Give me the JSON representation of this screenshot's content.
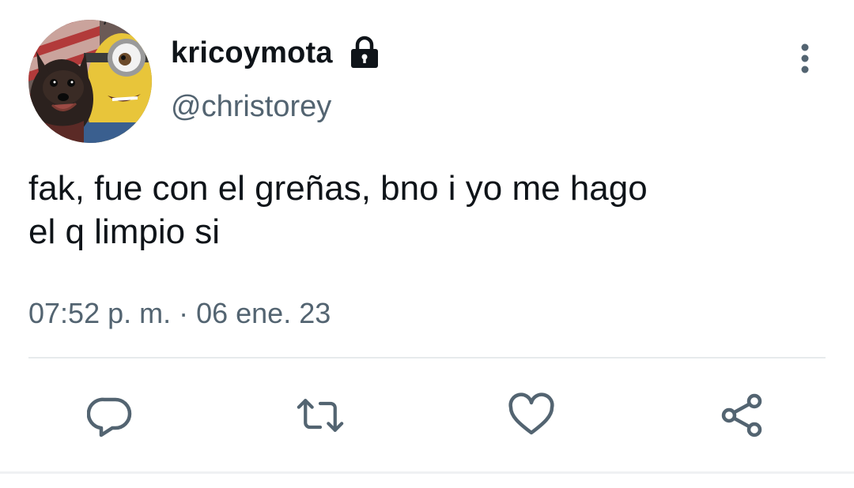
{
  "tweet": {
    "display_name": "kricoymota",
    "handle": "@christorey",
    "text_line1": "fak, fue con el greñas, bno i yo me hago",
    "text_line2": "el q limpio si",
    "timestamp": "07:52 p. m. · 06 ene. 23",
    "protected": true
  },
  "icons": {
    "lock": "lock-icon",
    "more": "more-vertical-icon",
    "reply": "reply-bubble-icon",
    "retweet": "retweet-icon",
    "like": "heart-icon",
    "share": "share-icon"
  },
  "colors": {
    "text_primary": "#0f1419",
    "text_secondary": "#536471",
    "icon": "#536471",
    "divider": "#e7eaec"
  }
}
